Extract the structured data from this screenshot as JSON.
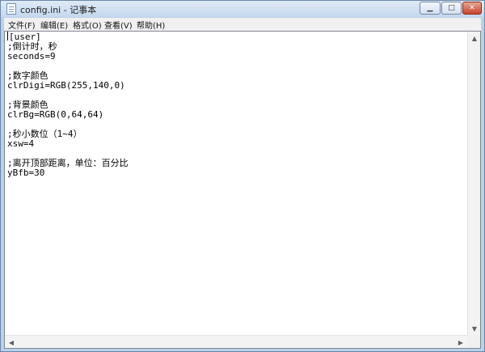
{
  "window": {
    "title": "config.ini - 记事本"
  },
  "controls": {
    "minimize": "▁",
    "maximize": "□",
    "close": "✕"
  },
  "menu": {
    "items": [
      "文件(F)",
      "编辑(E)",
      "格式(O)",
      "查看(V)",
      "帮助(H)"
    ]
  },
  "editor": {
    "first_line": "[user]",
    "rest": "\n;倒计时，秒\nseconds=9\n\n;数字颜色\nclrDigi=RGB(255,140,0)\n\n;背景颜色\nclrBg=RGB(0,64,64)\n\n;秒小数位（1~4）\nxsw=4\n\n;离开顶部距离，单位：百分比\nyBfb=30"
  },
  "scrollbar": {
    "up": "▲",
    "down": "▼",
    "left": "◀",
    "right": "▶"
  },
  "icons": [
    "notepad-icon"
  ]
}
